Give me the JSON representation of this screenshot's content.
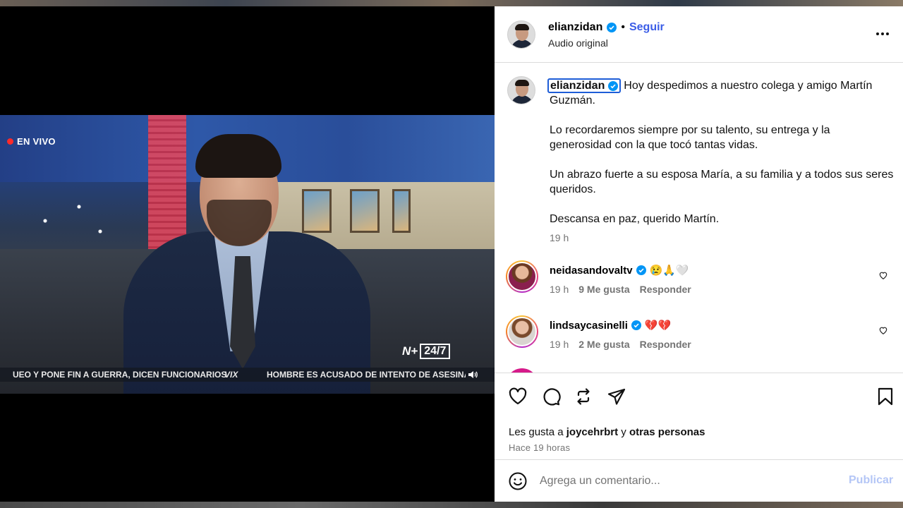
{
  "video": {
    "live_label": "EN VIVO",
    "channel_logo_left": "N+",
    "channel_logo_right": "24/7",
    "ticker_left": "UEO Y PONE FIN A GUERRA, DICEN FUNCIONARIOS",
    "ticker_brand": "VIX",
    "ticker_right": "HOMBRE ES ACUSADO DE INTENTO DE ASESINATO DE"
  },
  "post": {
    "username": "elianzidan",
    "follow_label": "Seguir",
    "separator": "•",
    "audio_label": "Audio original",
    "caption_user": "elianzidan",
    "caption_line1": "Hoy despedimos a nuestro colega y amigo Martín Guzmán.",
    "caption_line2": "Lo recordaremos siempre por su talento, su entrega y la generosidad con la que tocó tantas vidas.",
    "caption_line3": "Un abrazo fuerte a su esposa María, a su familia y a todos sus seres queridos.",
    "caption_line4": "Descansa en paz, querido Martín.",
    "caption_time": "19 h"
  },
  "comments": [
    {
      "user": "neidasandovaltv",
      "text": "😢🙏🤍",
      "time": "19 h",
      "likes": "9 Me gusta",
      "reply": "Responder"
    },
    {
      "user": "lindsaycasinelli",
      "text": "💔💔",
      "time": "19 h",
      "likes": "2 Me gusta",
      "reply": "Responder"
    }
  ],
  "likes_line": {
    "prefix": "Les gusta a",
    "user": "joycehrbrt",
    "conj": "y",
    "others": "otras personas"
  },
  "post_time": "Hace 19 horas",
  "add_comment": {
    "placeholder": "Agrega un comentario...",
    "publish_label": "Publicar"
  },
  "colors": {
    "follow": "#3b5de7",
    "verified": "#0095f6",
    "publish_disabled": "#b4c6f6",
    "live_dot": "#ff2a2a"
  },
  "icons": [
    "verified-icon",
    "more-options-icon",
    "heart-icon",
    "comment-icon",
    "repost-icon",
    "share-icon",
    "bookmark-icon",
    "emoji-icon",
    "volume-icon"
  ]
}
